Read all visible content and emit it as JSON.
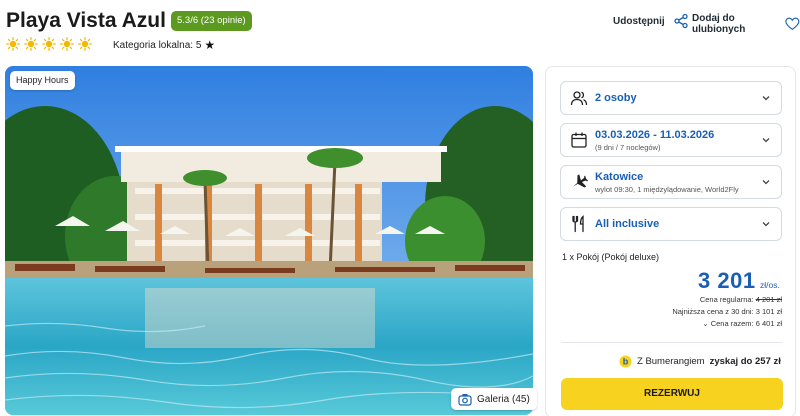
{
  "header": {
    "hotel_name": "Playa Vista Azul",
    "rating_badge": "5.3/6 (23 opinie)",
    "sun_rating": 5,
    "local_category_label": "Kategoria lokalna: 5",
    "share_label": "Udostępnij",
    "favorite_label": "Dodaj do ulubionych"
  },
  "hero": {
    "badge": "Happy Hours",
    "gallery_label": "Galeria (45)"
  },
  "booking": {
    "travelers": "2 osoby",
    "dates": "03.03.2026 - 11.03.2026",
    "dates_sub": "(9 dni / 7 noclegów)",
    "departure_city": "Katowice",
    "departure_sub": "wylot 09:30, 1 międzylądowanie, World2Fly",
    "board": "All inclusive",
    "room": "1 x Pokój  (Pokój deluxe)",
    "price": "3 201",
    "price_unit": "zł/os.",
    "regular_price_label": "Cena regularna:",
    "regular_price": "4 201 zł",
    "lowest_30_days": "Najniższa cena z 30 dni: 3 101 zł",
    "total_price": "Cena razem: 6 401 zł",
    "bumerang_prefix": "Z Bumerangiem",
    "bumerang_bold": "zyskaj do 257 zł",
    "reserve_label": "REZERWUJ"
  },
  "colors": {
    "accent_blue": "#1a5fb4",
    "badge_green": "#5b9a1e",
    "reserve_yellow": "#f7d21e",
    "sun_yellow": "#f5b800"
  }
}
